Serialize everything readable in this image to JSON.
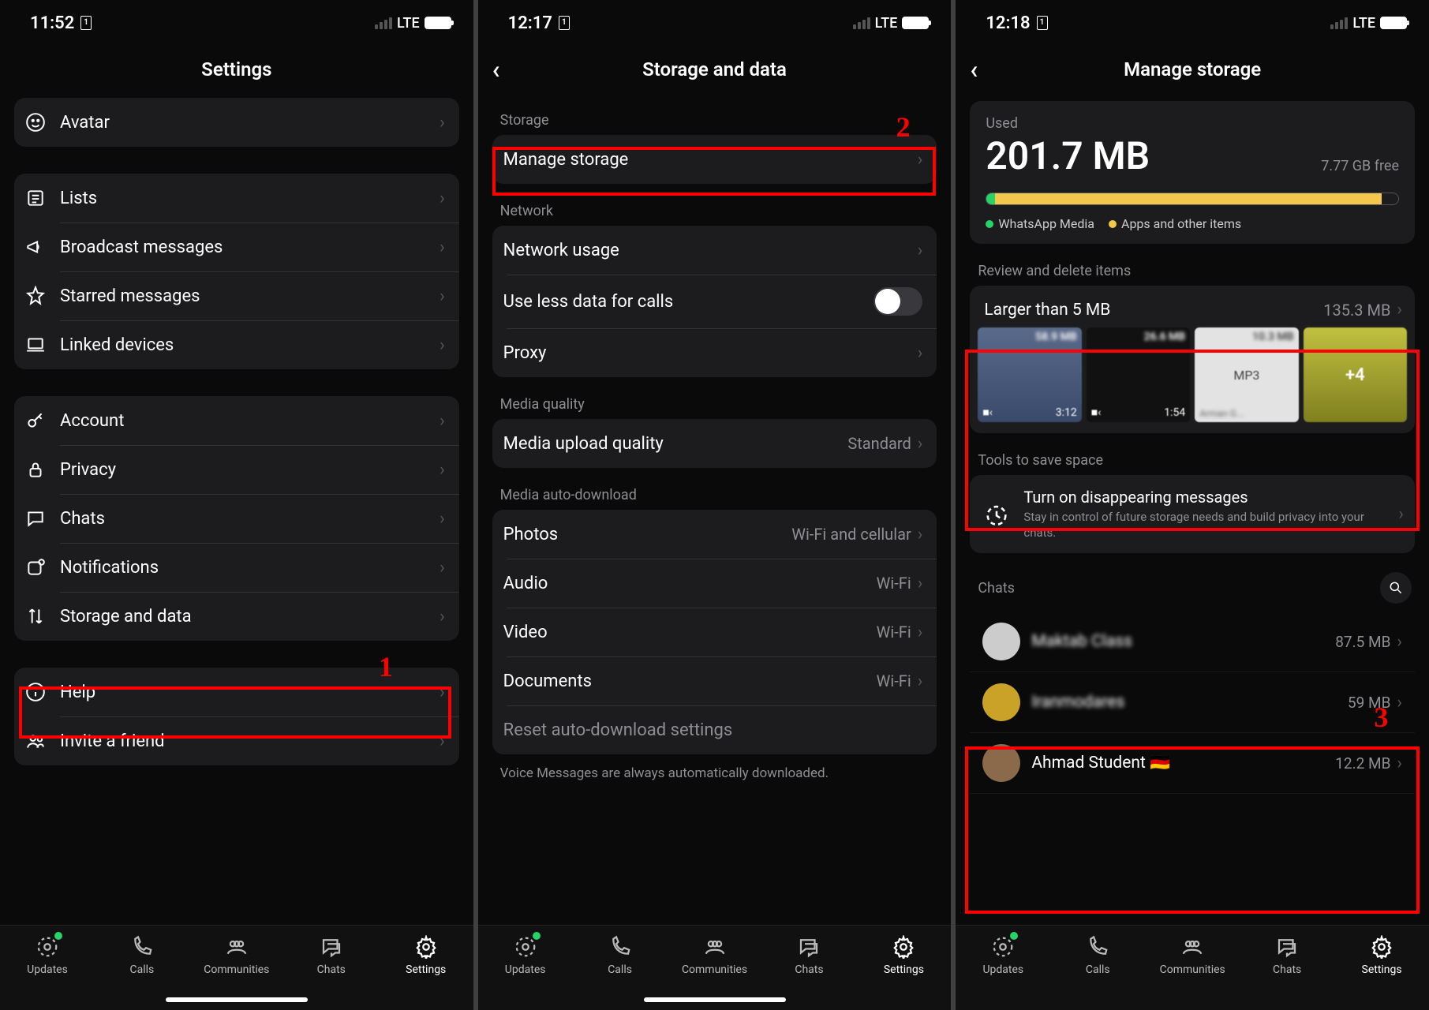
{
  "status": {
    "times": [
      "11:52",
      "12:17",
      "12:18"
    ],
    "network": "LTE"
  },
  "tabs": {
    "updates": "Updates",
    "calls": "Calls",
    "communities": "Communities",
    "chats": "Chats",
    "settings": "Settings"
  },
  "annotations": {
    "n1": "1",
    "n2": "2",
    "n3": "3"
  },
  "screen1": {
    "title": "Settings",
    "items": {
      "avatar": "Avatar",
      "lists": "Lists",
      "broadcast": "Broadcast messages",
      "starred": "Starred messages",
      "linked": "Linked devices",
      "account": "Account",
      "privacy": "Privacy",
      "chats": "Chats",
      "notifications": "Notifications",
      "storage": "Storage and data",
      "help": "Help",
      "invite": "Invite a friend"
    }
  },
  "screen2": {
    "title": "Storage and data",
    "sections": {
      "storage": "Storage",
      "network": "Network",
      "media_quality": "Media quality",
      "auto_download": "Media auto-download"
    },
    "items": {
      "manage_storage": "Manage storage",
      "network_usage": "Network usage",
      "use_less_data": "Use less data for calls",
      "proxy": "Proxy",
      "upload_quality": "Media upload quality",
      "upload_quality_value": "Standard",
      "photos": "Photos",
      "photos_value": "Wi-Fi and cellular",
      "audio": "Audio",
      "audio_value": "Wi-Fi",
      "video": "Video",
      "video_value": "Wi-Fi",
      "documents": "Documents",
      "documents_value": "Wi-Fi",
      "reset": "Reset auto-download settings"
    },
    "footnote": "Voice Messages are always automatically downloaded."
  },
  "screen3": {
    "title": "Manage storage",
    "used_label": "Used",
    "used_value": "201.7 MB",
    "free_value": "7.77 GB free",
    "legend": {
      "media": "WhatsApp Media",
      "apps": "Apps and other items"
    },
    "review_header": "Review and delete items",
    "larger_title": "Larger than 5 MB",
    "larger_size": "135.3 MB",
    "thumbs": [
      {
        "size": "58.9 MB",
        "dur": "3:12"
      },
      {
        "size": "26.6 MB",
        "dur": "1:54"
      },
      {
        "size": "10.3 MB",
        "label": "MP3",
        "sub": "Arman G..."
      },
      {
        "size": "",
        "label": "+4"
      }
    ],
    "tools_header": "Tools to save space",
    "tool_title": "Turn on disappearing messages",
    "tool_sub": "Stay in control of future storage needs and build privacy into your chats.",
    "chats_header": "Chats",
    "chats": [
      {
        "name": "Maktab Class",
        "size": "87.5 MB"
      },
      {
        "name": "Iranmodares",
        "size": "59 MB"
      },
      {
        "name": "Ahmad Student 🇩🇪",
        "size": "12.2 MB"
      }
    ]
  }
}
